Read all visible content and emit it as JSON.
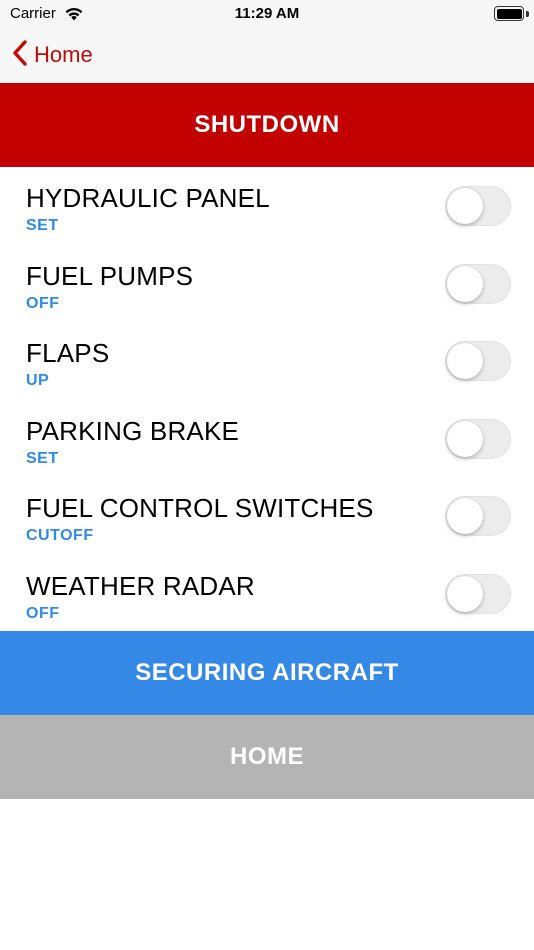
{
  "status_bar": {
    "carrier": "Carrier",
    "time": "11:29 AM",
    "wifi_icon": "wifi-icon",
    "battery_icon": "battery-icon"
  },
  "nav": {
    "back_label": "Home",
    "back_icon": "chevron-left-icon"
  },
  "header": {
    "title": "SHUTDOWN"
  },
  "checklist": [
    {
      "label": "HYDRAULIC PANEL",
      "value": "SET",
      "checked": false
    },
    {
      "label": "FUEL PUMPS",
      "value": "OFF",
      "checked": false
    },
    {
      "label": "FLAPS",
      "value": "UP",
      "checked": false
    },
    {
      "label": "PARKING BRAKE",
      "value": "SET",
      "checked": false
    },
    {
      "label": "FUEL CONTROL SWITCHES",
      "value": "CUTOFF",
      "checked": false
    },
    {
      "label": "WEATHER RADAR",
      "value": "OFF",
      "checked": false
    }
  ],
  "buttons": {
    "next_label": "SECURING AIRCRAFT",
    "home_label": "HOME"
  },
  "colors": {
    "header_red": "#c20000",
    "nav_red": "#c10a0a",
    "value_blue": "#2f8be8",
    "next_blue": "#3489e6",
    "home_gray": "#b4b4b4"
  }
}
